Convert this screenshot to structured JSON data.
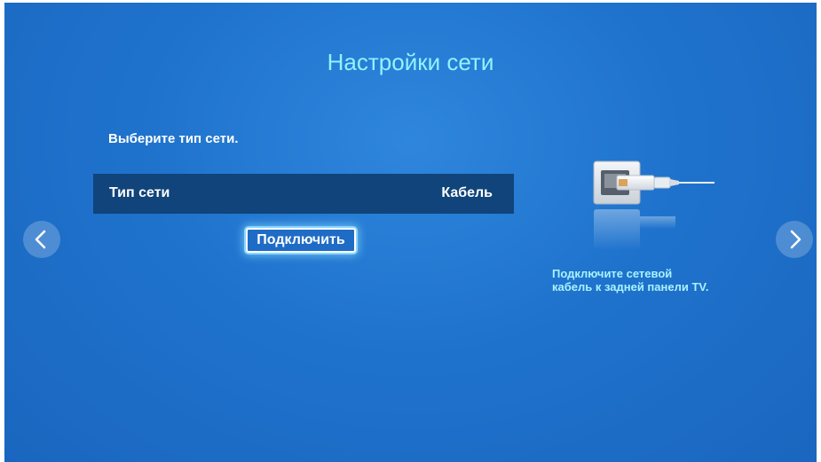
{
  "screen": {
    "title": "Настройки сети",
    "prompt": "Выберите тип сети.",
    "network_type": {
      "label": "Тип сети",
      "value": "Кабель"
    },
    "connect_button": "Подключить",
    "hint_lines": [
      "Подключите сетевой",
      "кабель к задней панели TV."
    ],
    "nav": {
      "prev_icon": "chevron-left-icon",
      "next_icon": "chevron-right-icon"
    },
    "illustration_icon": "network-cable-icon",
    "colors": {
      "background": "#1f73cd",
      "title": "#8ff4ff",
      "row_background": "#10447a",
      "focus_glow": "#8bd6ff",
      "hint_text": "#a9f2ff"
    }
  }
}
